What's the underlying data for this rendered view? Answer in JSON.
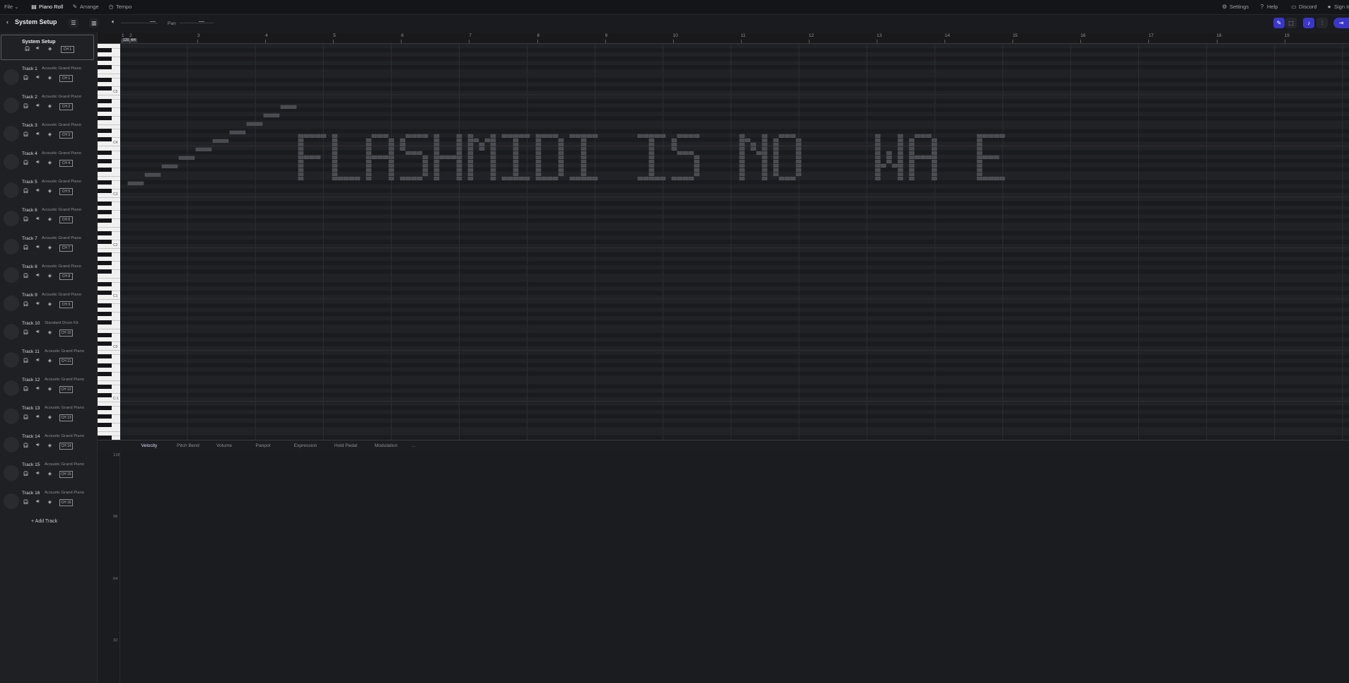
{
  "topbar": {
    "file": "File",
    "piano_roll": "Piano Roll",
    "arrange": "Arrange",
    "tempo": "Tempo",
    "settings": "Settings",
    "help": "Help",
    "discord": "Discord",
    "sign_in": "Sign In"
  },
  "header": {
    "title": "System Setup",
    "pan_label": "Pan"
  },
  "system_setup": {
    "title": "System Setup",
    "channel": "CH 1"
  },
  "tracks": [
    {
      "name": "Track 1",
      "instrument": "Acoustic Grand Piano",
      "channel": "CH 1"
    },
    {
      "name": "Track 2",
      "instrument": "Acoustic Grand Piano",
      "channel": "CH 2"
    },
    {
      "name": "Track 3",
      "instrument": "Acoustic Grand Piano",
      "channel": "CH 3"
    },
    {
      "name": "Track 4",
      "instrument": "Acoustic Grand Piano",
      "channel": "CH 4"
    },
    {
      "name": "Track 5",
      "instrument": "Acoustic Grand Piano",
      "channel": "CH 5"
    },
    {
      "name": "Track 6",
      "instrument": "Acoustic Grand Piano",
      "channel": "CH 6"
    },
    {
      "name": "Track 7",
      "instrument": "Acoustic Grand Piano",
      "channel": "CH 7"
    },
    {
      "name": "Track 8",
      "instrument": "Acoustic Grand Piano",
      "channel": "CH 8"
    },
    {
      "name": "Track 9",
      "instrument": "Acoustic Grand Piano",
      "channel": "CH 9"
    },
    {
      "name": "Track 10",
      "instrument": "Standard Drum Kit",
      "channel": "CH 10"
    },
    {
      "name": "Track 11",
      "instrument": "Acoustic Grand Piano",
      "channel": "CH 11"
    },
    {
      "name": "Track 12",
      "instrument": "Acoustic Grand Piano",
      "channel": "CH 12"
    },
    {
      "name": "Track 13",
      "instrument": "Acoustic Grand Piano",
      "channel": "CH 13"
    },
    {
      "name": "Track 14",
      "instrument": "Acoustic Grand Piano",
      "channel": "CH 14"
    },
    {
      "name": "Track 15",
      "instrument": "Acoustic Grand Piano",
      "channel": "CH 15"
    },
    {
      "name": "Track 16",
      "instrument": "Acoustic Grand Piano",
      "channel": "CH 16"
    }
  ],
  "add_track": "Add Track",
  "ruler": {
    "bars": [
      "1",
      "2",
      "3",
      "4",
      "5",
      "6",
      "7",
      "8",
      "9",
      "10",
      "11",
      "12",
      "13",
      "14",
      "15",
      "16",
      "17",
      "18",
      "19"
    ],
    "tempo_badge": "120",
    "time_sig_badge": "4/4"
  },
  "piano_labels": [
    "C5",
    "C4",
    "C3",
    "C2",
    "C1",
    "C0",
    "C-1"
  ],
  "controller_tabs": [
    "Velocity",
    "Pitch Bend",
    "Volume",
    "Panpot",
    "Expression",
    "Hold Pedal",
    "Modulation",
    "..."
  ],
  "velocity_axis": [
    "128",
    "96",
    "64",
    "32"
  ]
}
